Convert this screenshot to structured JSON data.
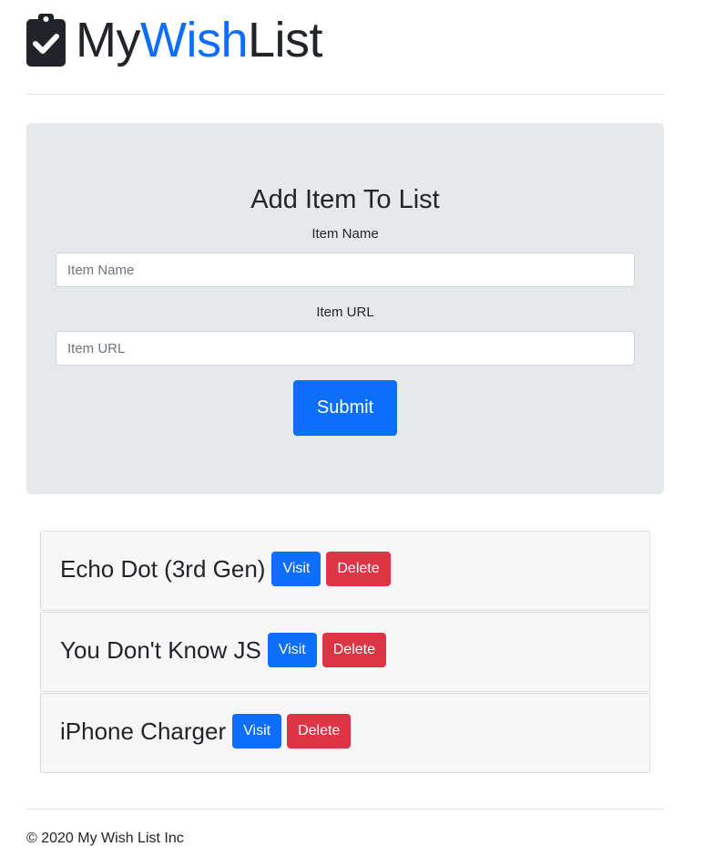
{
  "header": {
    "brand_part1": "My",
    "brand_part2": "Wish",
    "brand_part3": "List",
    "logo_icon": "clipboard-check-icon",
    "accent_color": "#0d6efd"
  },
  "form": {
    "title": "Add Item To List",
    "name_label": "Item Name",
    "name_placeholder": "Item Name",
    "name_value": "",
    "url_label": "Item URL",
    "url_placeholder": "Item URL",
    "url_value": "",
    "submit_label": "Submit"
  },
  "items": [
    {
      "name": "Echo Dot (3rd Gen)",
      "visit_label": "Visit",
      "delete_label": "Delete"
    },
    {
      "name": "You Don't Know JS",
      "visit_label": "Visit",
      "delete_label": "Delete"
    },
    {
      "name": "iPhone Charger",
      "visit_label": "Visit",
      "delete_label": "Delete"
    }
  ],
  "colors": {
    "primary": "#0d6efd",
    "danger": "#dc3545",
    "jumbotron_bg": "#e6e9ec"
  },
  "footer": {
    "text": "© 2020 My Wish List Inc"
  }
}
